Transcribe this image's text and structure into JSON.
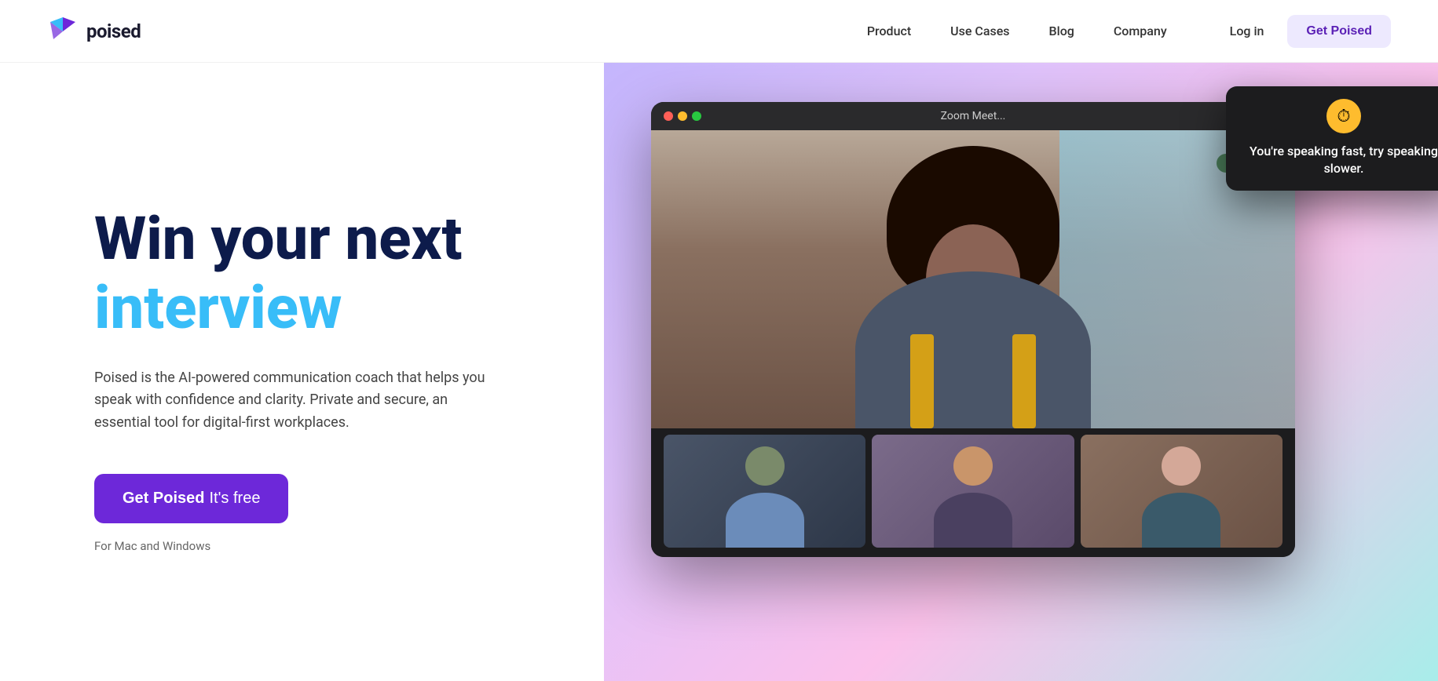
{
  "nav": {
    "logo_text": "poised",
    "links": [
      {
        "label": "Product",
        "href": "#"
      },
      {
        "label": "Use Cases",
        "href": "#"
      },
      {
        "label": "Blog",
        "href": "#"
      },
      {
        "label": "Company",
        "href": "#"
      }
    ],
    "login_label": "Log in",
    "get_poised_label": "Get Poised"
  },
  "hero": {
    "headline_line1": "Win your next",
    "headline_line2": "interview",
    "description": "Poised is the AI-powered communication coach that helps you speak with confidence and clarity. Private and secure, an essential tool for digital-first workplaces.",
    "cta_bold": "Get Poised",
    "cta_light": "It's free",
    "platform_note": "For Mac and Windows"
  },
  "zoom_mock": {
    "title": "Zoom Meet...",
    "tooltip_message": "You're speaking fast, try speaking slower.",
    "timer_emoji": "⏱"
  }
}
